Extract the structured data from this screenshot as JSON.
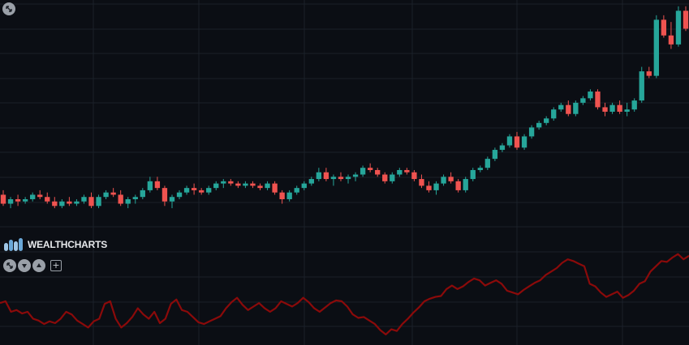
{
  "logo": {
    "brand": "WEALTHCHARTS"
  },
  "controls": {
    "top_icon": "collapse-arrows-icon",
    "panel_icons": [
      "collapse-arrows-icon",
      "move-down-icon",
      "move-up-icon"
    ],
    "add_icon": "plus-icon",
    "add_label": "+"
  },
  "colors": {
    "background": "#0b0e14",
    "grid": "#1b2029",
    "up": "#26a69a",
    "down": "#ef5350",
    "indicator": "#8b0a0a",
    "button": "#9aa0a8"
  },
  "chart_data": [
    {
      "type": "candlestick",
      "title": "",
      "xlabel": "",
      "ylabel": "",
      "ylim": [
        0,
        100
      ],
      "grid": true,
      "candles": [
        {
          "o": 15,
          "h": 17,
          "l": 10,
          "c": 11
        },
        {
          "o": 11,
          "h": 14,
          "l": 9,
          "c": 13
        },
        {
          "o": 13,
          "h": 15,
          "l": 10,
          "c": 12
        },
        {
          "o": 12,
          "h": 14,
          "l": 11,
          "c": 13
        },
        {
          "o": 13,
          "h": 16,
          "l": 12,
          "c": 15
        },
        {
          "o": 15,
          "h": 17,
          "l": 13,
          "c": 14
        },
        {
          "o": 14,
          "h": 16,
          "l": 11,
          "c": 12
        },
        {
          "o": 12,
          "h": 14,
          "l": 9,
          "c": 10
        },
        {
          "o": 10,
          "h": 13,
          "l": 9,
          "c": 12
        },
        {
          "o": 12,
          "h": 14,
          "l": 10,
          "c": 11
        },
        {
          "o": 11,
          "h": 13,
          "l": 10,
          "c": 12
        },
        {
          "o": 12,
          "h": 15,
          "l": 11,
          "c": 14
        },
        {
          "o": 14,
          "h": 16,
          "l": 9,
          "c": 10
        },
        {
          "o": 10,
          "h": 15,
          "l": 9,
          "c": 14
        },
        {
          "o": 14,
          "h": 17,
          "l": 13,
          "c": 16
        },
        {
          "o": 16,
          "h": 18,
          "l": 14,
          "c": 15
        },
        {
          "o": 15,
          "h": 17,
          "l": 10,
          "c": 11
        },
        {
          "o": 11,
          "h": 14,
          "l": 9,
          "c": 13
        },
        {
          "o": 13,
          "h": 15,
          "l": 11,
          "c": 14
        },
        {
          "o": 14,
          "h": 18,
          "l": 13,
          "c": 17
        },
        {
          "o": 17,
          "h": 23,
          "l": 16,
          "c": 21
        },
        {
          "o": 21,
          "h": 23,
          "l": 17,
          "c": 18
        },
        {
          "o": 18,
          "h": 19,
          "l": 10,
          "c": 12
        },
        {
          "o": 12,
          "h": 15,
          "l": 9,
          "c": 14
        },
        {
          "o": 14,
          "h": 17,
          "l": 13,
          "c": 16
        },
        {
          "o": 16,
          "h": 19,
          "l": 15,
          "c": 18
        },
        {
          "o": 18,
          "h": 20,
          "l": 15,
          "c": 17
        },
        {
          "o": 17,
          "h": 18,
          "l": 15,
          "c": 16
        },
        {
          "o": 16,
          "h": 19,
          "l": 15,
          "c": 18
        },
        {
          "o": 18,
          "h": 21,
          "l": 17,
          "c": 20
        },
        {
          "o": 20,
          "h": 22,
          "l": 18,
          "c": 21
        },
        {
          "o": 21,
          "h": 22,
          "l": 19,
          "c": 20
        },
        {
          "o": 20,
          "h": 21,
          "l": 18,
          "c": 19
        },
        {
          "o": 19,
          "h": 21,
          "l": 18,
          "c": 20
        },
        {
          "o": 20,
          "h": 21,
          "l": 18,
          "c": 19
        },
        {
          "o": 19,
          "h": 20,
          "l": 17,
          "c": 18
        },
        {
          "o": 18,
          "h": 21,
          "l": 17,
          "c": 20
        },
        {
          "o": 20,
          "h": 21,
          "l": 15,
          "c": 16
        },
        {
          "o": 16,
          "h": 17,
          "l": 11,
          "c": 13
        },
        {
          "o": 13,
          "h": 17,
          "l": 12,
          "c": 16
        },
        {
          "o": 16,
          "h": 19,
          "l": 15,
          "c": 18
        },
        {
          "o": 18,
          "h": 21,
          "l": 17,
          "c": 20
        },
        {
          "o": 20,
          "h": 23,
          "l": 19,
          "c": 22
        },
        {
          "o": 22,
          "h": 27,
          "l": 21,
          "c": 25
        },
        {
          "o": 25,
          "h": 27,
          "l": 21,
          "c": 22
        },
        {
          "o": 22,
          "h": 24,
          "l": 19,
          "c": 23
        },
        {
          "o": 23,
          "h": 25,
          "l": 21,
          "c": 22
        },
        {
          "o": 22,
          "h": 24,
          "l": 20,
          "c": 23
        },
        {
          "o": 23,
          "h": 25,
          "l": 21,
          "c": 24
        },
        {
          "o": 24,
          "h": 28,
          "l": 23,
          "c": 27
        },
        {
          "o": 27,
          "h": 29,
          "l": 25,
          "c": 26
        },
        {
          "o": 26,
          "h": 27,
          "l": 23,
          "c": 24
        },
        {
          "o": 24,
          "h": 25,
          "l": 20,
          "c": 21
        },
        {
          "o": 21,
          "h": 25,
          "l": 20,
          "c": 24
        },
        {
          "o": 24,
          "h": 27,
          "l": 23,
          "c": 26
        },
        {
          "o": 26,
          "h": 27,
          "l": 24,
          "c": 25
        },
        {
          "o": 25,
          "h": 26,
          "l": 21,
          "c": 22
        },
        {
          "o": 22,
          "h": 24,
          "l": 18,
          "c": 19
        },
        {
          "o": 19,
          "h": 21,
          "l": 16,
          "c": 17
        },
        {
          "o": 17,
          "h": 21,
          "l": 15,
          "c": 20
        },
        {
          "o": 20,
          "h": 24,
          "l": 19,
          "c": 23
        },
        {
          "o": 23,
          "h": 25,
          "l": 20,
          "c": 21
        },
        {
          "o": 21,
          "h": 22,
          "l": 16,
          "c": 17
        },
        {
          "o": 17,
          "h": 23,
          "l": 16,
          "c": 22
        },
        {
          "o": 22,
          "h": 27,
          "l": 21,
          "c": 26
        },
        {
          "o": 26,
          "h": 28,
          "l": 25,
          "c": 27
        },
        {
          "o": 27,
          "h": 32,
          "l": 26,
          "c": 31
        },
        {
          "o": 31,
          "h": 36,
          "l": 30,
          "c": 35
        },
        {
          "o": 35,
          "h": 38,
          "l": 34,
          "c": 37
        },
        {
          "o": 37,
          "h": 42,
          "l": 36,
          "c": 41
        },
        {
          "o": 41,
          "h": 43,
          "l": 35,
          "c": 36
        },
        {
          "o": 36,
          "h": 42,
          "l": 35,
          "c": 41
        },
        {
          "o": 41,
          "h": 46,
          "l": 40,
          "c": 45
        },
        {
          "o": 45,
          "h": 48,
          "l": 44,
          "c": 47
        },
        {
          "o": 47,
          "h": 50,
          "l": 46,
          "c": 49
        },
        {
          "o": 49,
          "h": 54,
          "l": 48,
          "c": 53
        },
        {
          "o": 53,
          "h": 56,
          "l": 52,
          "c": 55
        },
        {
          "o": 55,
          "h": 57,
          "l": 50,
          "c": 51
        },
        {
          "o": 51,
          "h": 57,
          "l": 50,
          "c": 56
        },
        {
          "o": 56,
          "h": 59,
          "l": 55,
          "c": 58
        },
        {
          "o": 58,
          "h": 62,
          "l": 57,
          "c": 61
        },
        {
          "o": 61,
          "h": 62,
          "l": 53,
          "c": 54
        },
        {
          "o": 54,
          "h": 56,
          "l": 50,
          "c": 52
        },
        {
          "o": 52,
          "h": 56,
          "l": 51,
          "c": 55
        },
        {
          "o": 55,
          "h": 57,
          "l": 51,
          "c": 52
        },
        {
          "o": 52,
          "h": 56,
          "l": 50,
          "c": 53
        },
        {
          "o": 53,
          "h": 58,
          "l": 52,
          "c": 57
        },
        {
          "o": 57,
          "h": 72,
          "l": 56,
          "c": 70
        },
        {
          "o": 70,
          "h": 72,
          "l": 67,
          "c": 68
        },
        {
          "o": 68,
          "h": 95,
          "l": 67,
          "c": 93
        },
        {
          "o": 93,
          "h": 95,
          "l": 85,
          "c": 86
        },
        {
          "o": 86,
          "h": 92,
          "l": 80,
          "c": 82
        },
        {
          "o": 82,
          "h": 99,
          "l": 81,
          "c": 97
        },
        {
          "o": 97,
          "h": 99,
          "l": 88,
          "c": 89
        }
      ]
    },
    {
      "type": "line",
      "title": "",
      "xlabel": "",
      "ylabel": "",
      "ylim": [
        0,
        100
      ],
      "grid": true,
      "series": [
        {
          "values": [
            48,
            50,
            38,
            40,
            36,
            38,
            30,
            28,
            24,
            27,
            25,
            30,
            38,
            35,
            28,
            24,
            20,
            27,
            30,
            47,
            50,
            30,
            20,
            25,
            32,
            42,
            35,
            30,
            38,
            25,
            30,
            47,
            52,
            40,
            38,
            32,
            26,
            24,
            27,
            30,
            33,
            42,
            49,
            54,
            46,
            40,
            44,
            48,
            42,
            38,
            42,
            50,
            47,
            44,
            48,
            54,
            49,
            42,
            38,
            43,
            48,
            51,
            50,
            44,
            35,
            31,
            32,
            28,
            24,
            17,
            12,
            18,
            16,
            24,
            30,
            37,
            43,
            50,
            53,
            55,
            56,
            64,
            68,
            64,
            67,
            72,
            76,
            74,
            68,
            71,
            74,
            70,
            62,
            60,
            58,
            63,
            67,
            71,
            74,
            80,
            84,
            88,
            94,
            98,
            96,
            93,
            90,
            70,
            67,
            60,
            55,
            58,
            61,
            54,
            57,
            62,
            70,
            73,
            84,
            90,
            96,
            95,
            100,
            104,
            98,
            102
          ]
        }
      ]
    }
  ]
}
